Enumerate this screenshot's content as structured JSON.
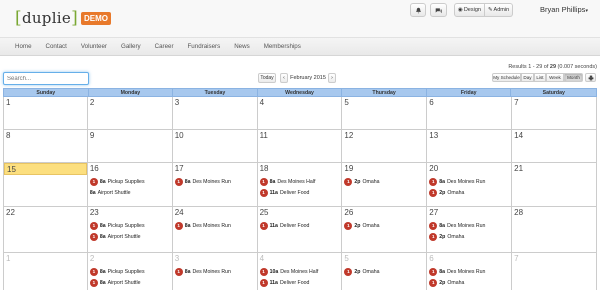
{
  "brand": {
    "name": "duplie",
    "bracket_open": "[",
    "bracket_close": "]",
    "badge": "DEMO"
  },
  "header": {
    "design_label": "Design",
    "admin_label": "Admin",
    "user_name": "Bryan Phillips"
  },
  "nav": [
    "Home",
    "Contact",
    "Volunteer",
    "Gallery",
    "Career",
    "Fundraisers",
    "News",
    "Memberships"
  ],
  "search": {
    "placeholder": "Search..."
  },
  "datebar": {
    "today_label": "Today",
    "prev": "‹",
    "next": "›",
    "month": "February 2015"
  },
  "results": {
    "prefix": "Results 1 - 29 of ",
    "count": "29",
    "suffix": " (0.007 seconds)"
  },
  "views": {
    "my_schedule": "My Schedule",
    "day": "Day",
    "list": "List",
    "week": "Week",
    "month": "Month",
    "print": "print-icon"
  },
  "weekdays": [
    "Sunday",
    "Monday",
    "Tuesday",
    "Wednesday",
    "Thursday",
    "Friday",
    "Saturday"
  ],
  "weeks": [
    {
      "days": [
        {
          "n": "1"
        },
        {
          "n": "2"
        },
        {
          "n": "3"
        },
        {
          "n": "4"
        },
        {
          "n": "5"
        },
        {
          "n": "6"
        },
        {
          "n": "7"
        }
      ]
    },
    {
      "days": [
        {
          "n": "8"
        },
        {
          "n": "9"
        },
        {
          "n": "10"
        },
        {
          "n": "11"
        },
        {
          "n": "12"
        },
        {
          "n": "13"
        },
        {
          "n": "14"
        }
      ]
    },
    {
      "days": [
        {
          "n": "15",
          "today": true
        },
        {
          "n": "16",
          "events": [
            {
              "badge": "1",
              "time": "8a",
              "title": "Pickup Supplies"
            },
            {
              "badge": "",
              "time": "8a",
              "title": "Airport Shuttle"
            }
          ]
        },
        {
          "n": "17",
          "events": [
            {
              "badge": "1",
              "time": "8a",
              "title": "Des Moines Run"
            }
          ]
        },
        {
          "n": "18",
          "events": [
            {
              "badge": "1",
              "time": "8a",
              "title": "Des Moines Half"
            },
            {
              "badge": "1",
              "time": "11a",
              "title": "Deliver Food"
            }
          ]
        },
        {
          "n": "19",
          "events": [
            {
              "badge": "1",
              "time": "2p",
              "title": "Omaha"
            }
          ]
        },
        {
          "n": "20",
          "events": [
            {
              "badge": "1",
              "time": "8a",
              "title": "Des Moines Run"
            },
            {
              "badge": "1",
              "time": "2p",
              "title": "Omaha"
            }
          ]
        },
        {
          "n": "21"
        }
      ]
    },
    {
      "days": [
        {
          "n": "22"
        },
        {
          "n": "23",
          "events": [
            {
              "badge": "1",
              "time": "8a",
              "title": "Pickup Supplies"
            },
            {
              "badge": "1",
              "time": "8a",
              "title": "Airport Shuttle"
            }
          ]
        },
        {
          "n": "24",
          "events": [
            {
              "badge": "1",
              "time": "8a",
              "title": "Des Moines Run"
            }
          ]
        },
        {
          "n": "25",
          "events": [
            {
              "badge": "1",
              "time": "11a",
              "title": "Deliver Food"
            }
          ]
        },
        {
          "n": "26",
          "events": [
            {
              "badge": "1",
              "time": "2p",
              "title": "Omaha"
            }
          ]
        },
        {
          "n": "27",
          "events": [
            {
              "badge": "1",
              "time": "8a",
              "title": "Des Moines Run"
            },
            {
              "badge": "1",
              "time": "2p",
              "title": "Omaha"
            }
          ]
        },
        {
          "n": "28"
        }
      ]
    },
    {
      "days": [
        {
          "n": "1",
          "muted": true
        },
        {
          "n": "2",
          "muted": true,
          "events": [
            {
              "badge": "1",
              "time": "8a",
              "title": "Pickup Supplies"
            },
            {
              "badge": "1",
              "time": "8a",
              "title": "Airport Shuttle"
            }
          ]
        },
        {
          "n": "3",
          "muted": true,
          "events": [
            {
              "badge": "1",
              "time": "8a",
              "title": "Des Moines Run"
            }
          ]
        },
        {
          "n": "4",
          "muted": true,
          "events": [
            {
              "badge": "1",
              "time": "10a",
              "title": "Des Moines Half"
            },
            {
              "badge": "1",
              "time": "11a",
              "title": "Deliver Food"
            }
          ]
        },
        {
          "n": "5",
          "muted": true,
          "events": [
            {
              "badge": "1",
              "time": "2p",
              "title": "Omaha"
            }
          ]
        },
        {
          "n": "6",
          "muted": true,
          "events": [
            {
              "badge": "1",
              "time": "8a",
              "title": "Des Moines Run"
            },
            {
              "badge": "1",
              "time": "2p",
              "title": "Omaha"
            }
          ]
        },
        {
          "n": "7",
          "muted": true
        }
      ]
    }
  ],
  "colors": {
    "today": "#fcdf7f",
    "badge": "#c0392b",
    "header": "#a7c8ee",
    "brand_accent": "#7aa833",
    "demo_badge": "#e8792b"
  }
}
